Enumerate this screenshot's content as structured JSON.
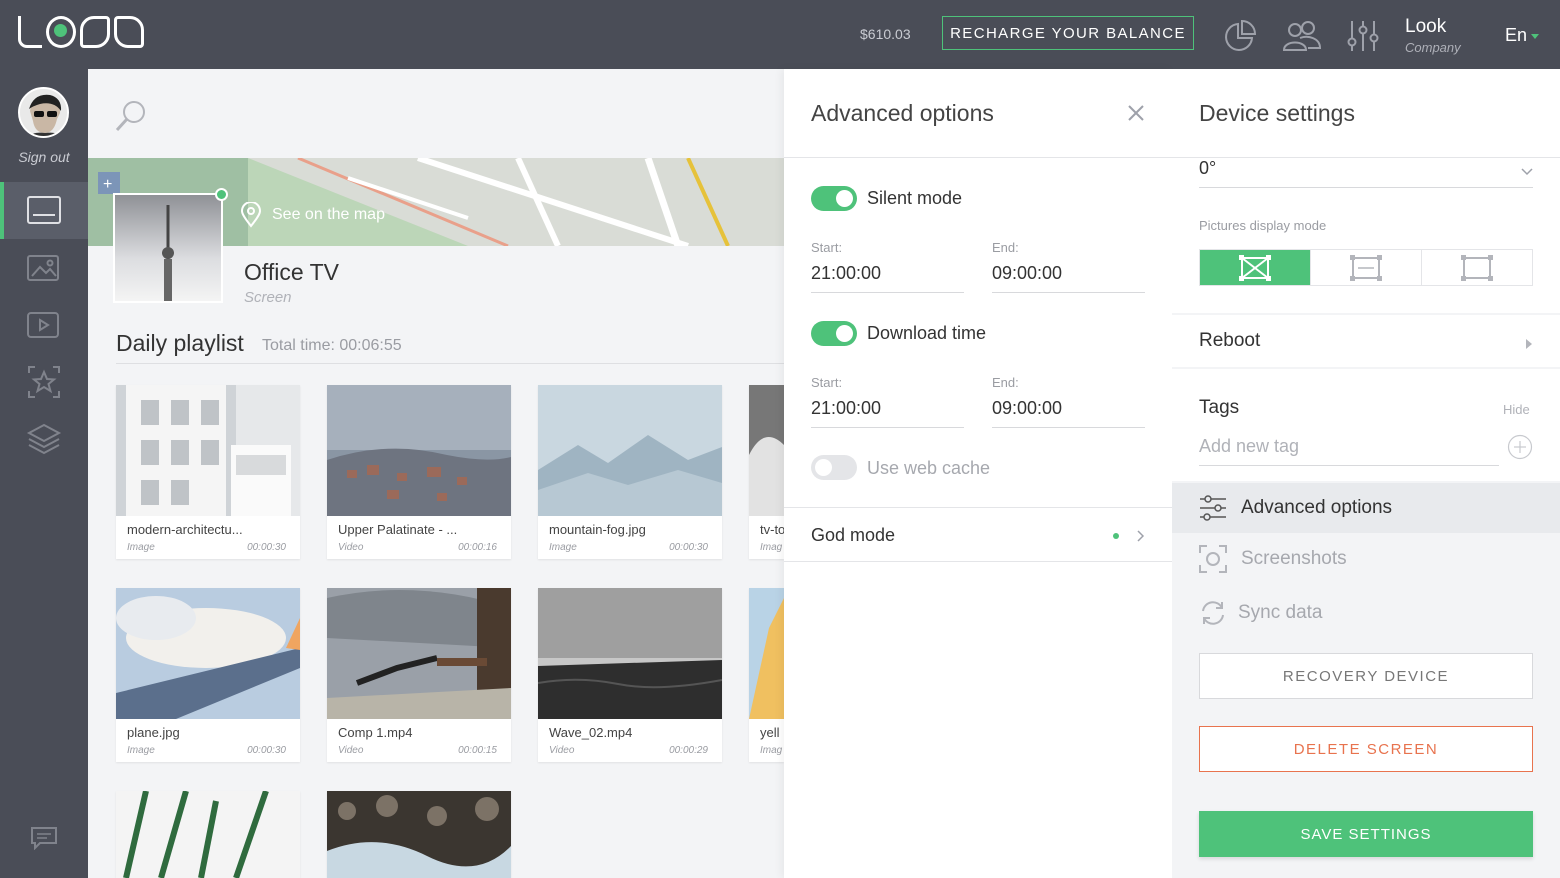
{
  "header": {
    "balance": "$610.03",
    "recharge_label": "RECHARGE YOUR BALANCE",
    "user_name": "Look",
    "user_company": "Company",
    "language": "En"
  },
  "sidebar": {
    "signout_label": "Sign out",
    "items": [
      {
        "icon": "screen-icon",
        "active": true
      },
      {
        "icon": "images-icon",
        "active": false
      },
      {
        "icon": "playlist-icon",
        "active": false
      },
      {
        "icon": "star-icon",
        "active": false
      },
      {
        "icon": "layers-icon",
        "active": false
      }
    ]
  },
  "device": {
    "see_on_map": "See on the map",
    "name": "Office TV",
    "type": "Screen"
  },
  "playlist": {
    "title": "Daily playlist",
    "total_time": "Total time: 00:06:55",
    "items": [
      {
        "name": "modern-architectu...",
        "type": "Image",
        "duration": "00:00:30"
      },
      {
        "name": "Upper Palatinate - ...",
        "type": "Video",
        "duration": "00:00:16"
      },
      {
        "name": "mountain-fog.jpg",
        "type": "Image",
        "duration": "00:00:30"
      },
      {
        "name": "tv-to",
        "type": "Imag",
        "duration": ""
      },
      {
        "name": "plane.jpg",
        "type": "Image",
        "duration": "00:00:30"
      },
      {
        "name": "Comp 1.mp4",
        "type": "Video",
        "duration": "00:00:15"
      },
      {
        "name": "Wave_02.mp4",
        "type": "Video",
        "duration": "00:00:29"
      },
      {
        "name": "yell",
        "type": "Imag",
        "duration": ""
      }
    ]
  },
  "advanced": {
    "title": "Advanced options",
    "silent_mode": {
      "label": "Silent mode",
      "on": true,
      "start_label": "Start:",
      "start": "21:00:00",
      "end_label": "End:",
      "end": "09:00:00"
    },
    "download_time": {
      "label": "Download time",
      "on": true,
      "start_label": "Start:",
      "start": "21:00:00",
      "end_label": "End:",
      "end": "09:00:00"
    },
    "web_cache": {
      "label": "Use web cache",
      "on": false
    },
    "god_mode": {
      "label": "God mode"
    }
  },
  "device_settings": {
    "title": "Device settings",
    "rotation": "0°",
    "pictures_mode_label": "Pictures display mode",
    "reboot_label": "Reboot",
    "tags_label": "Tags",
    "tags_hide": "Hide",
    "tags_placeholder": "Add new tag",
    "menu": {
      "advanced": "Advanced options",
      "screenshots": "Screenshots",
      "sync": "Sync data"
    },
    "recovery_label": "RECOVERY DEVICE",
    "delete_label": "DELETE SCREEN",
    "save_label": "SAVE SETTINGS"
  },
  "colors": {
    "accent": "#4ec27a",
    "topbar": "#4a4d57",
    "danger": "#e8734e"
  }
}
